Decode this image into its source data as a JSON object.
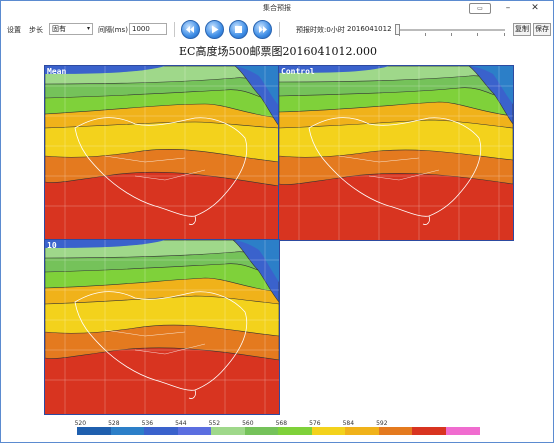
{
  "window": {
    "title": "集合预报"
  },
  "toolbar": {
    "settings_label": "设置",
    "step_label": "步长",
    "step_value": "固有",
    "interval_label": "间隔(ms)",
    "interval_value": "1000",
    "forecast_label": "预报时效:0小时",
    "date_value": "2016041012",
    "copy_label": "复制",
    "save_label": "保存",
    "icons": [
      "rewind-icon",
      "play-icon",
      "stop-icon",
      "fast-forward-icon"
    ]
  },
  "main": {
    "title": "EC高度场500邮票图2016041012.000",
    "panels": [
      {
        "label": "Mean"
      },
      {
        "label": "Control"
      },
      {
        "label": "10"
      }
    ]
  },
  "colorbar": {
    "labels": [
      "520",
      "528",
      "536",
      "544",
      "552",
      "560",
      "568",
      "576",
      "584",
      "592"
    ],
    "colors": [
      "#1f5fae",
      "#2c7fc8",
      "#3a62cc",
      "#5b6ee0",
      "#9fd88a",
      "#75c25a",
      "#7fd13a",
      "#f3d21c",
      "#f0b21a",
      "#e47a1f",
      "#d83420",
      "#f06ccf"
    ]
  }
}
